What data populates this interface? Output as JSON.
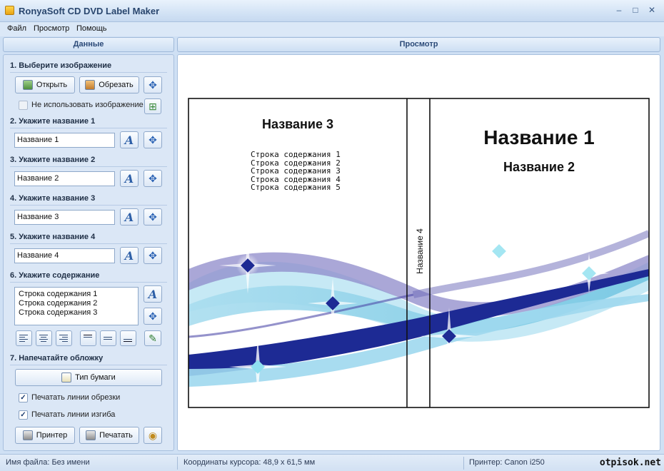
{
  "window": {
    "title": "RonyaSoft CD DVD Label Maker"
  },
  "menu": [
    "Файл",
    "Просмотр",
    "Помощь"
  ],
  "panels": {
    "data_header": "Данные",
    "preview_header": "Просмотр"
  },
  "sections": {
    "image": {
      "title": "1. Выберите изображение",
      "open_label": "Открыть",
      "crop_label": "Обрезать",
      "no_image_label": "Не использовать изображение"
    },
    "title1": {
      "title": "2. Укажите название 1",
      "value": "Название 1"
    },
    "title2": {
      "title": "3. Укажите название 2",
      "value": "Название 2"
    },
    "title3": {
      "title": "4. Укажите название 3",
      "value": "Название 3"
    },
    "title4": {
      "title": "5. Укажите название 4",
      "value": "Название 4"
    },
    "contents": {
      "title": "6. Укажите содержание",
      "lines": [
        "Строка содержания 1",
        "Строка содержания 2",
        "Строка содержания 3"
      ]
    },
    "print": {
      "title": "7. Напечатайте обложку",
      "paper_type_label": "Тип бумаги",
      "print_cut_lines_label": "Печатать линии обрезки",
      "print_fold_lines_label": "Печатать линии изгиба",
      "printer_label": "Принтер",
      "print_label": "Печатать"
    }
  },
  "preview": {
    "back_title": "Название 3",
    "back_lines": [
      "Строка содержания 1",
      "Строка содержания 2",
      "Строка содержания 3",
      "Строка содержания 4",
      "Строка содержания 5"
    ],
    "spine_title": "Название 4",
    "front_title": "Название 1",
    "front_subtitle": "Название 2"
  },
  "status": {
    "file_name": "Имя файла: Без имени",
    "cursor": "Координаты курсора:  48,9 x  61,5 мм",
    "printer": "Принтер: Canon i250",
    "watermark": "otpisok.net"
  },
  "colors": {
    "accent": "#2b4a78",
    "wave_dark": "#1f2f9a",
    "wave_light": "#8fd3ea",
    "wave_purple": "#7f7bc2"
  }
}
